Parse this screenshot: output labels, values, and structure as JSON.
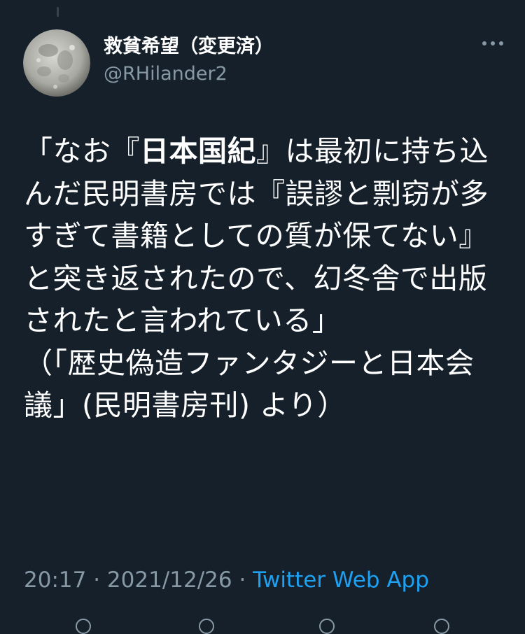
{
  "user": {
    "display_name": "救貧希望（変更済）",
    "handle": "@RHilander2",
    "avatar": "moon-avatar"
  },
  "tweet": {
    "segments": [
      {
        "text": "「なお『",
        "bold": false
      },
      {
        "text": "日本国紀",
        "bold": true
      },
      {
        "text": "』は最初に持ち込んだ民明書房では『誤謬と剽窃が多すぎて書籍としての質が保てない』と突き返されたので、幻冬舎で出版されたと言われている」",
        "bold": false
      },
      {
        "text": "\n（「歴史偽造ファンタジーと日本会議」(民明書房刊) より）",
        "bold": false
      }
    ]
  },
  "meta": {
    "time": "20:17",
    "separator1": " · ",
    "date": "2021/12/26",
    "separator2": " · ",
    "source": "Twitter Web App"
  },
  "icons": {
    "more": "more-horizontal-icon"
  },
  "colors": {
    "background": "#15202b",
    "secondary_text": "#8899a6",
    "link": "#1da1f2"
  }
}
